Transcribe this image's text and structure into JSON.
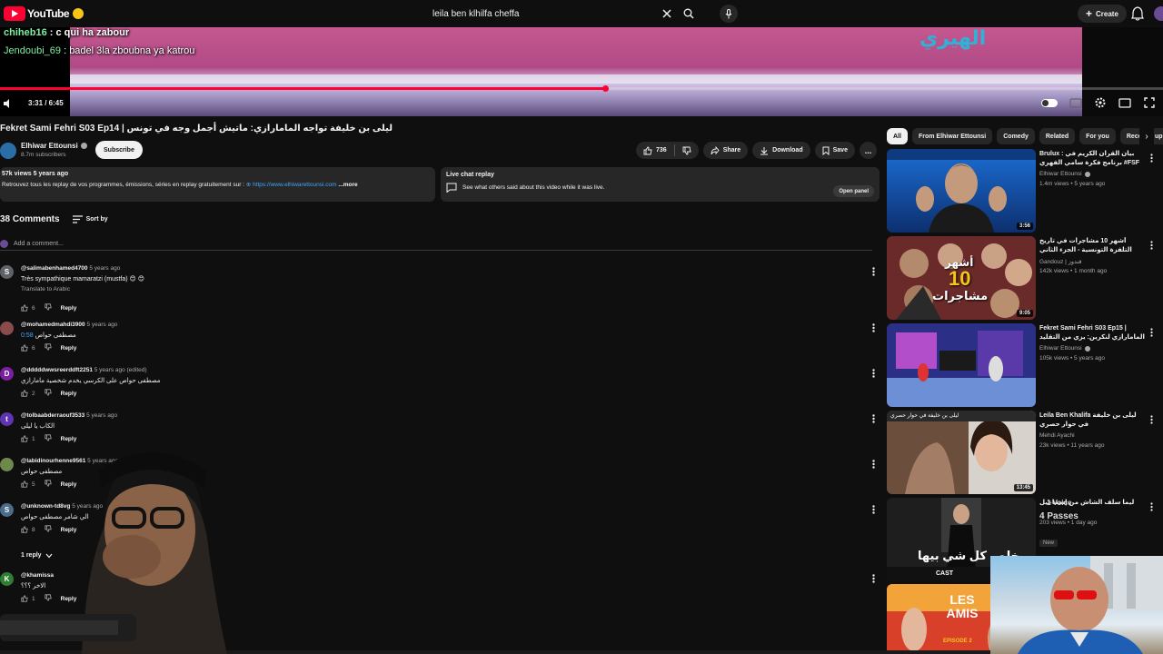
{
  "header": {
    "logo_text": "YouTube",
    "search_value": "leila ben klhilfa cheffa",
    "create_label": "Create"
  },
  "player": {
    "chat": [
      {
        "user": "chiheb16",
        "message": "c qui ha zabour"
      },
      {
        "user": "Jendoubi_69",
        "message": "badel 3la zboubna ya katrou"
      }
    ],
    "time": "3:31 / 6:45",
    "progress_fraction": 0.52
  },
  "video": {
    "title": "Fekret Sami Fehri S03 Ep14 | ليلى بن خليفة تواجه المامارازي: ماتيش أجمل وجه في تونس",
    "channel": "Elhiwar Ettounsi",
    "subscribers": "8.7m subscribers",
    "subscribe_label": "Subscribe",
    "likes": "736",
    "share_label": "Share",
    "download_label": "Download",
    "save_label": "Save",
    "more_label": "...",
    "views_date": "57k views  5 years ago",
    "description": "Retrouvez tous les replay de vos programmes, émissions, séries en replay gratuitement sur :",
    "description_link": "https://www.elhiwarettounsi.com",
    "description_more": "...more"
  },
  "live_chat": {
    "title": "Live chat replay",
    "text": "See what others said about this video while it was live.",
    "button": "Open panel"
  },
  "comments": {
    "count": "38 Comments",
    "sort_label": "Sort by",
    "add_placeholder": "Add a comment...",
    "translate_label": "Translate to Arabic",
    "reply_label": "Reply",
    "replies_label": "1 reply",
    "items": [
      {
        "initial": "S",
        "color": "#5f6368",
        "handle": "@salimabenhamed4700",
        "time": "5 years ago",
        "body": "Très sympathique mamaratzi (mustfa) 😊 😊",
        "likes": "6"
      },
      {
        "initial": "",
        "color": "#8a4b4b",
        "handle": "@mohamedmahdi3900",
        "time": "5 years ago",
        "body": "مصطفى حواص",
        "link": "0:58",
        "likes": "6"
      },
      {
        "initial": "D",
        "color": "#7b1fa2",
        "handle": "@dddddwwsreerddft2251",
        "time": "5 years ago (edited)",
        "body": "مصطفى حواص على الكرسي يخدم شخصية مامارازي",
        "likes": "2"
      },
      {
        "initial": "t",
        "color": "#5e35b1",
        "handle": "@tolbaabderraouf3533",
        "time": "5 years ago",
        "body": "الكاب يا ليلى",
        "likes": "1"
      },
      {
        "initial": "",
        "color": "#6d8a4b",
        "handle": "@labidinourhenne9561",
        "time": "5 years ago",
        "body": "مصطفى حواص",
        "likes": "5"
      },
      {
        "initial": "S",
        "color": "#4b6d8a",
        "handle": "@unknown-td8vg",
        "time": "5 years ago",
        "body": "الي شامر مصطفى حواص",
        "likes": "8"
      },
      {
        "initial": "K",
        "color": "#2e7d32",
        "handle": "@khamissa",
        "time": "",
        "body": "الاخر ؟؟؟",
        "likes": "1"
      }
    ]
  },
  "filters": [
    "All",
    "From Elhiwar Ettounsi",
    "Comedy",
    "Related",
    "For you",
    "Recently uploaded"
  ],
  "recommendations": [
    {
      "title": "Brulux : بيان القرآن الكريم في برنامج فكرة سامي الفهري #FSF",
      "channel": "Elhiwar Ettounsi",
      "verified": true,
      "meta": "1.4m views • 5 years ago",
      "duration": "3:56"
    },
    {
      "title": "أشهر 10 مشاجرات في تاريخ التلفزة التونسية - الجزء الثاني",
      "channel": "Gandouz | قندوز",
      "verified": false,
      "meta": "142k views • 1 month ago",
      "duration": "9:05"
    },
    {
      "title": "Fekret Sami Fehri S03 Ep15 | المامارازي لنكرين: يزي من التقليد !!",
      "channel": "Elhiwar Ettounsi",
      "verified": true,
      "meta": "105k views • 5 years ago",
      "duration": ""
    },
    {
      "title": "Leila Ben Khalifa ليلى بن خليفة في حوار حصري",
      "channel": "Mehdi Ayachi",
      "verified": false,
      "meta": "23k views • 11 years ago",
      "duration": "13:45"
    },
    {
      "title": "ليما سلف الشاش من إسماعيل",
      "channel": "",
      "verified": false,
      "meta": "203 views • 1 day ago",
      "duration": "",
      "badge": "New"
    },
    {
      "title": "",
      "channel": "",
      "verified": false,
      "meta": "",
      "duration": ""
    }
  ],
  "overlay_texts": {
    "thumb2_big": "10",
    "thumb2_word": "مشاجرات",
    "thumb2_top": "أشهر",
    "thumb4_caption": "ليلى بن خليفة في حوار حصري",
    "thumb5_caption": "خلص كل شي بيها",
    "thumb5_cast": "CAST",
    "thumb6_text": "LES AMIS",
    "thumb6_episode": "EPISODE 2",
    "rec5_overlay1": "1 Voice",
    "rec5_overlay2": "4 Passes"
  },
  "colors": {
    "accent": "#ff0033",
    "background": "#0f0f0f",
    "surface": "#272727",
    "link": "#3ea6ff",
    "chat_user": "#7ef0a0"
  }
}
